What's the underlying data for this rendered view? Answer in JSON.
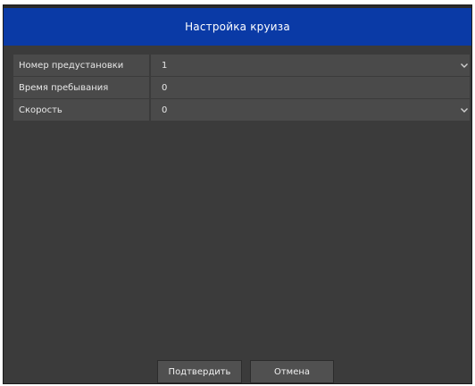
{
  "dialog": {
    "title": "Настройка круиза"
  },
  "fields": [
    {
      "label": "Номер предустановки",
      "value": "1",
      "has_dropdown": true
    },
    {
      "label": "Время пребывания",
      "value": "0",
      "has_dropdown": false
    },
    {
      "label": "Скорость",
      "value": "0",
      "has_dropdown": true
    }
  ],
  "buttons": {
    "confirm": "Подтвердить",
    "cancel": "Отмена"
  },
  "colors": {
    "title_bar": "#0a3aa6",
    "background": "#3b3b3b",
    "field": "#4a4a4a"
  },
  "icons": {
    "dropdown": "chevron-down-icon"
  }
}
